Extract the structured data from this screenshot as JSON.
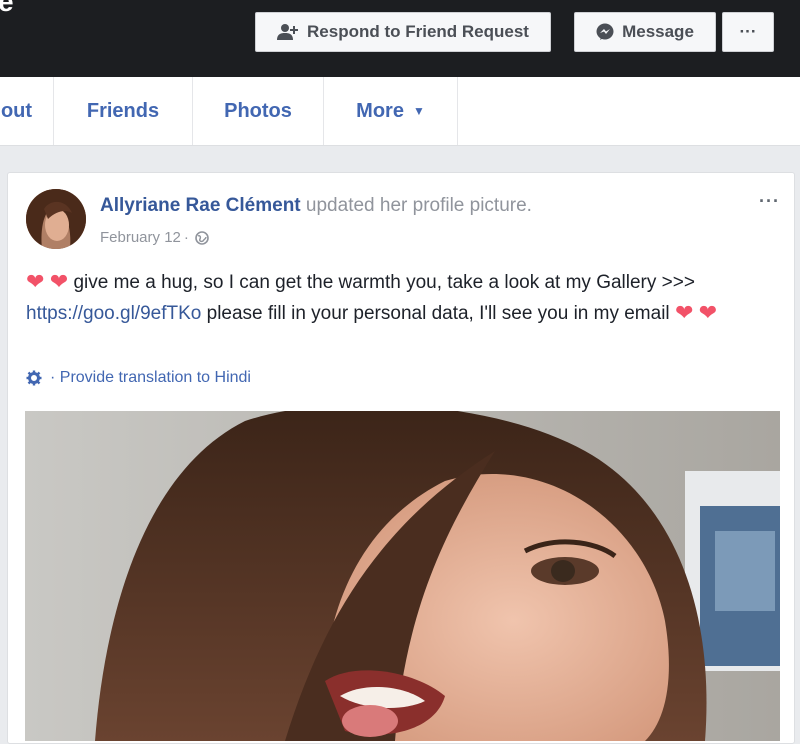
{
  "header": {
    "respond_label": "Respond to Friend Request",
    "message_label": "Message",
    "more_label": "···",
    "edge_fragment": "e"
  },
  "tabs": [
    {
      "label": "out"
    },
    {
      "label": "Friends"
    },
    {
      "label": "Photos"
    },
    {
      "label": "More"
    }
  ],
  "post": {
    "author": "Allyriane Rae Clément",
    "action": "updated her profile picture.",
    "date": "February 12",
    "date_sep": "·",
    "options_label": "···",
    "text_part1": "give me a hug, so I can get the warmth you, take a look at my Gallery >>>",
    "link": "https://goo.gl/9efTKo",
    "text_part2": "please fill in your personal data, I'll see you in my email",
    "heart": "❤",
    "translate_label": "· Provide translation to Hindi"
  },
  "colors": {
    "link_blue": "#365899",
    "tab_blue": "#4267b2",
    "heart_red": "#f25268",
    "dark_bar": "#1c1e21"
  },
  "icons": [
    "add-friend-icon",
    "messenger-icon",
    "globe-icon",
    "gear-icon",
    "caret-down-icon"
  ]
}
